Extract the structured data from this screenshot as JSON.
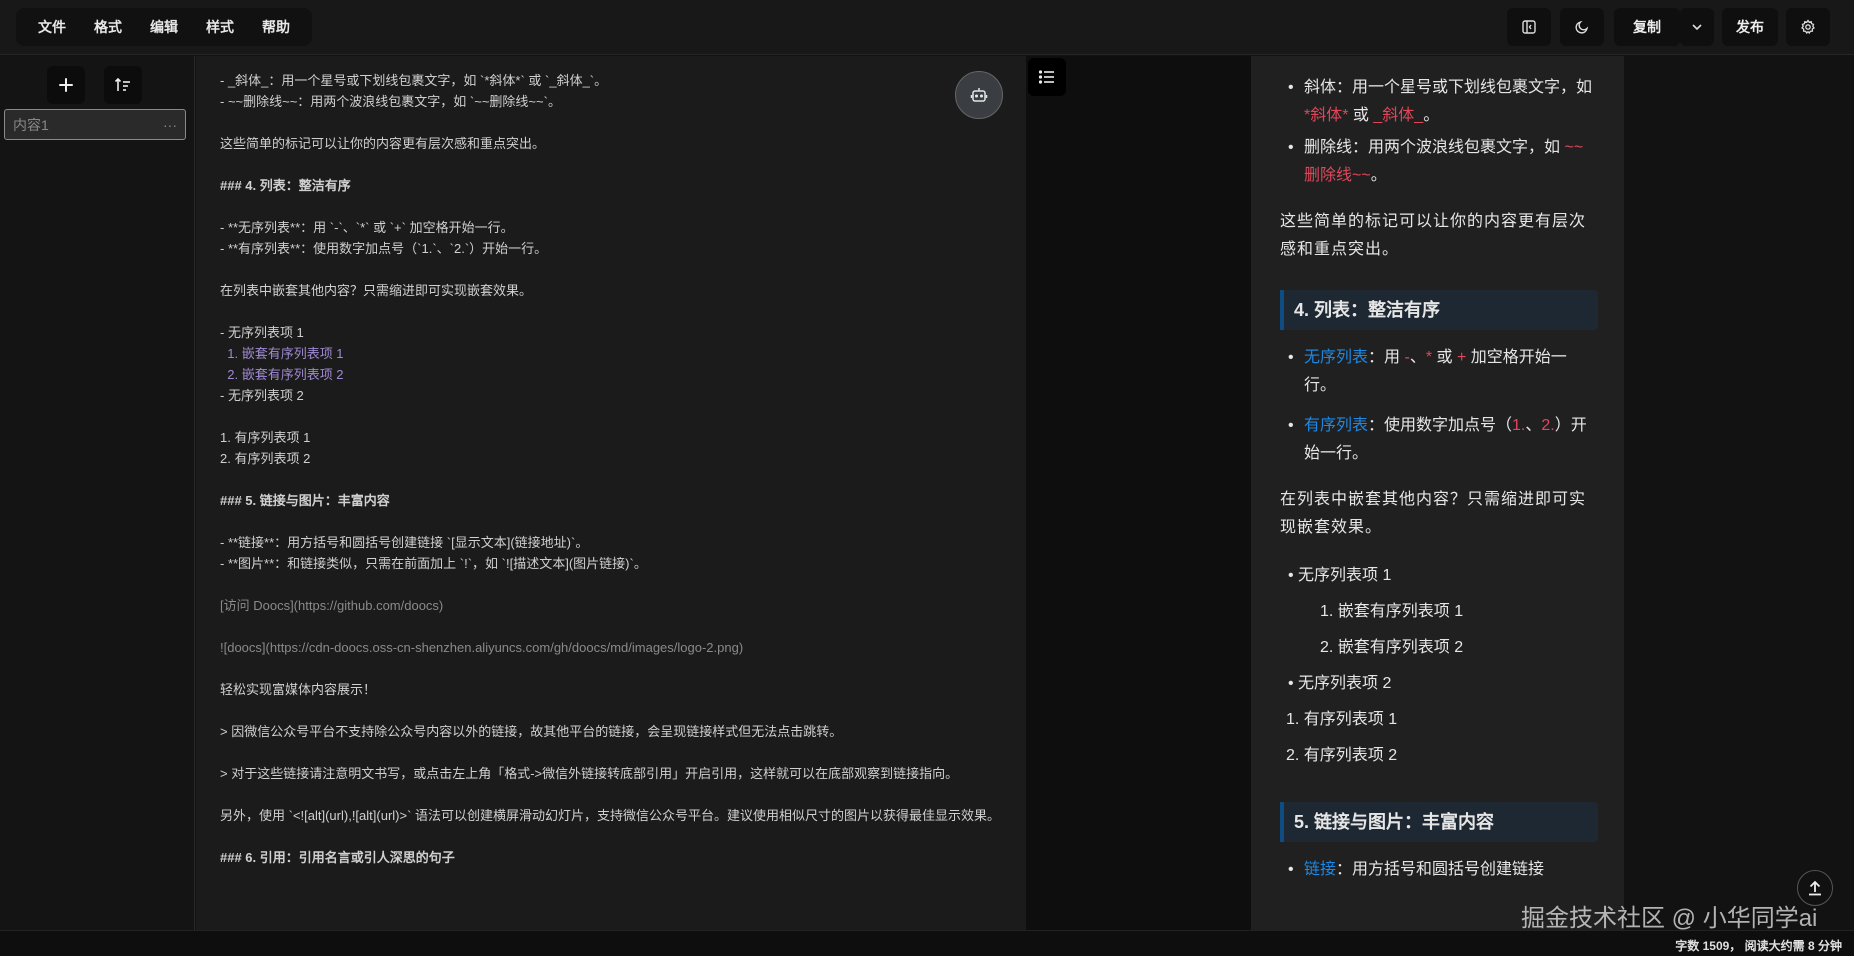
{
  "menu": [
    "文件",
    "格式",
    "编辑",
    "样式",
    "帮助"
  ],
  "toolbar": {
    "copy_label": "复制",
    "publish_label": "发布"
  },
  "sidebar": {
    "item_label": "内容1",
    "item_more": "···"
  },
  "editor": {
    "lines": [
      {
        "t": "- _斜体_：用一个星号或下划线包裹文字，如 `*斜体*` 或 `_斜体_`。"
      },
      {
        "t": "- ~~删除线~~：用两个波浪线包裹文字，如 `~~删除线~~`。"
      },
      {
        "t": ""
      },
      {
        "t": "这些简单的标记可以让你的内容更有层次感和重点突出。"
      },
      {
        "t": ""
      },
      {
        "t": "### 4. 列表：整洁有序",
        "c": "c-bold"
      },
      {
        "t": ""
      },
      {
        "t": "- **无序列表**：用 `-`、`*` 或 `+` 加空格开始一行。"
      },
      {
        "t": "- **有序列表**：使用数字加点号（`1.`、`2.`）开始一行。"
      },
      {
        "t": ""
      },
      {
        "t": "在列表中嵌套其他内容？只需缩进即可实现嵌套效果。"
      },
      {
        "t": ""
      },
      {
        "t": "- 无序列表项 1"
      },
      {
        "t": "  1. 嵌套有序列表项 1",
        "c": "c-purple"
      },
      {
        "t": "  2. 嵌套有序列表项 2",
        "c": "c-purple"
      },
      {
        "t": "- 无序列表项 2"
      },
      {
        "t": ""
      },
      {
        "t": "1. 有序列表项 1"
      },
      {
        "t": "2. 有序列表项 2"
      },
      {
        "t": ""
      },
      {
        "t": "### 5. 链接与图片：丰富内容",
        "c": "c-bold"
      },
      {
        "t": ""
      },
      {
        "t": "- **链接**：用方括号和圆括号创建链接 `[显示文本](链接地址)`。"
      },
      {
        "t": "- **图片**：和链接类似，只需在前面加上 `!`，如 `![描述文本](图片链接)`。"
      },
      {
        "t": ""
      },
      {
        "t": "[访问 Doocs](https://github.com/doocs)",
        "c": "c-dim"
      },
      {
        "t": ""
      },
      {
        "t": "![doocs](https://cdn-doocs.oss-cn-shenzhen.aliyuncs.com/gh/doocs/md/images/logo-2.png)",
        "c": "c-dim"
      },
      {
        "t": ""
      },
      {
        "t": "轻松实现富媒体内容展示！"
      },
      {
        "t": ""
      },
      {
        "t": "> 因微信公众号平台不支持除公众号内容以外的链接，故其他平台的链接，会呈现链接样式但无法点击跳转。"
      },
      {
        "t": ""
      },
      {
        "t": "> 对于这些链接请注意明文书写，或点击左上角「格式->微信外链接转底部引用」开启引用，这样就可以在底部观察到链接指向。"
      },
      {
        "t": ""
      },
      {
        "t": "另外，使用 `<![alt](url),![alt](url)>` 语法可以创建横屏滑动幻灯片，支持微信公众号平台。建议使用相似尺寸的图片以获得最佳显示效果。"
      },
      {
        "t": ""
      },
      {
        "t": "### 6. 引用：引用名言或引人深思的句子",
        "c": "c-bold"
      }
    ]
  },
  "preview": {
    "b1_prefix": "斜体：用一个星号或下划线包裹文字，如",
    "b1_code1": "*斜体*",
    "b1_mid": "或",
    "b1_code2": "_斜体_",
    "b1_end": "。",
    "b2_prefix": "删除线：用两个波浪线包裹文字，如",
    "b2_code": "~~删除线~~",
    "b2_end": "。",
    "p1": "这些简单的标记可以让你的内容更有层次感和重点突出。",
    "h4": "4. 列表：整洁有序",
    "l1_link": "无序列表",
    "l1_a": "：用",
    "l1_c1": "-",
    "l1_sep": "、",
    "l1_c2": "*",
    "l1_or": "或",
    "l1_c3": "+",
    "l1_end": "加空格开始一行。",
    "l2_link": "有序列表",
    "l2_a": "：使用数字加点号（",
    "l2_c1": "1.",
    "l2_sep": "、",
    "l2_c2": "2.",
    "l2_end": "）开始一行。",
    "p2": "在列表中嵌套其他内容？只需缩进即可实现嵌套效果。",
    "u1": "• 无序列表项 1",
    "n1": "1. 嵌套有序列表项 1",
    "n2": "2. 嵌套有序列表项 2",
    "u2": "• 无序列表项 2",
    "o1": "1. 有序列表项 1",
    "o2": "2. 有序列表项 2",
    "h5": "5. 链接与图片：丰富内容",
    "l3_link": "链接",
    "l3_text": "：用方括号和圆括号创建链接"
  },
  "watermark": "掘金技术社区 @ 小华同学ai",
  "status": "字数 1509， 阅读大约需 8 分钟"
}
